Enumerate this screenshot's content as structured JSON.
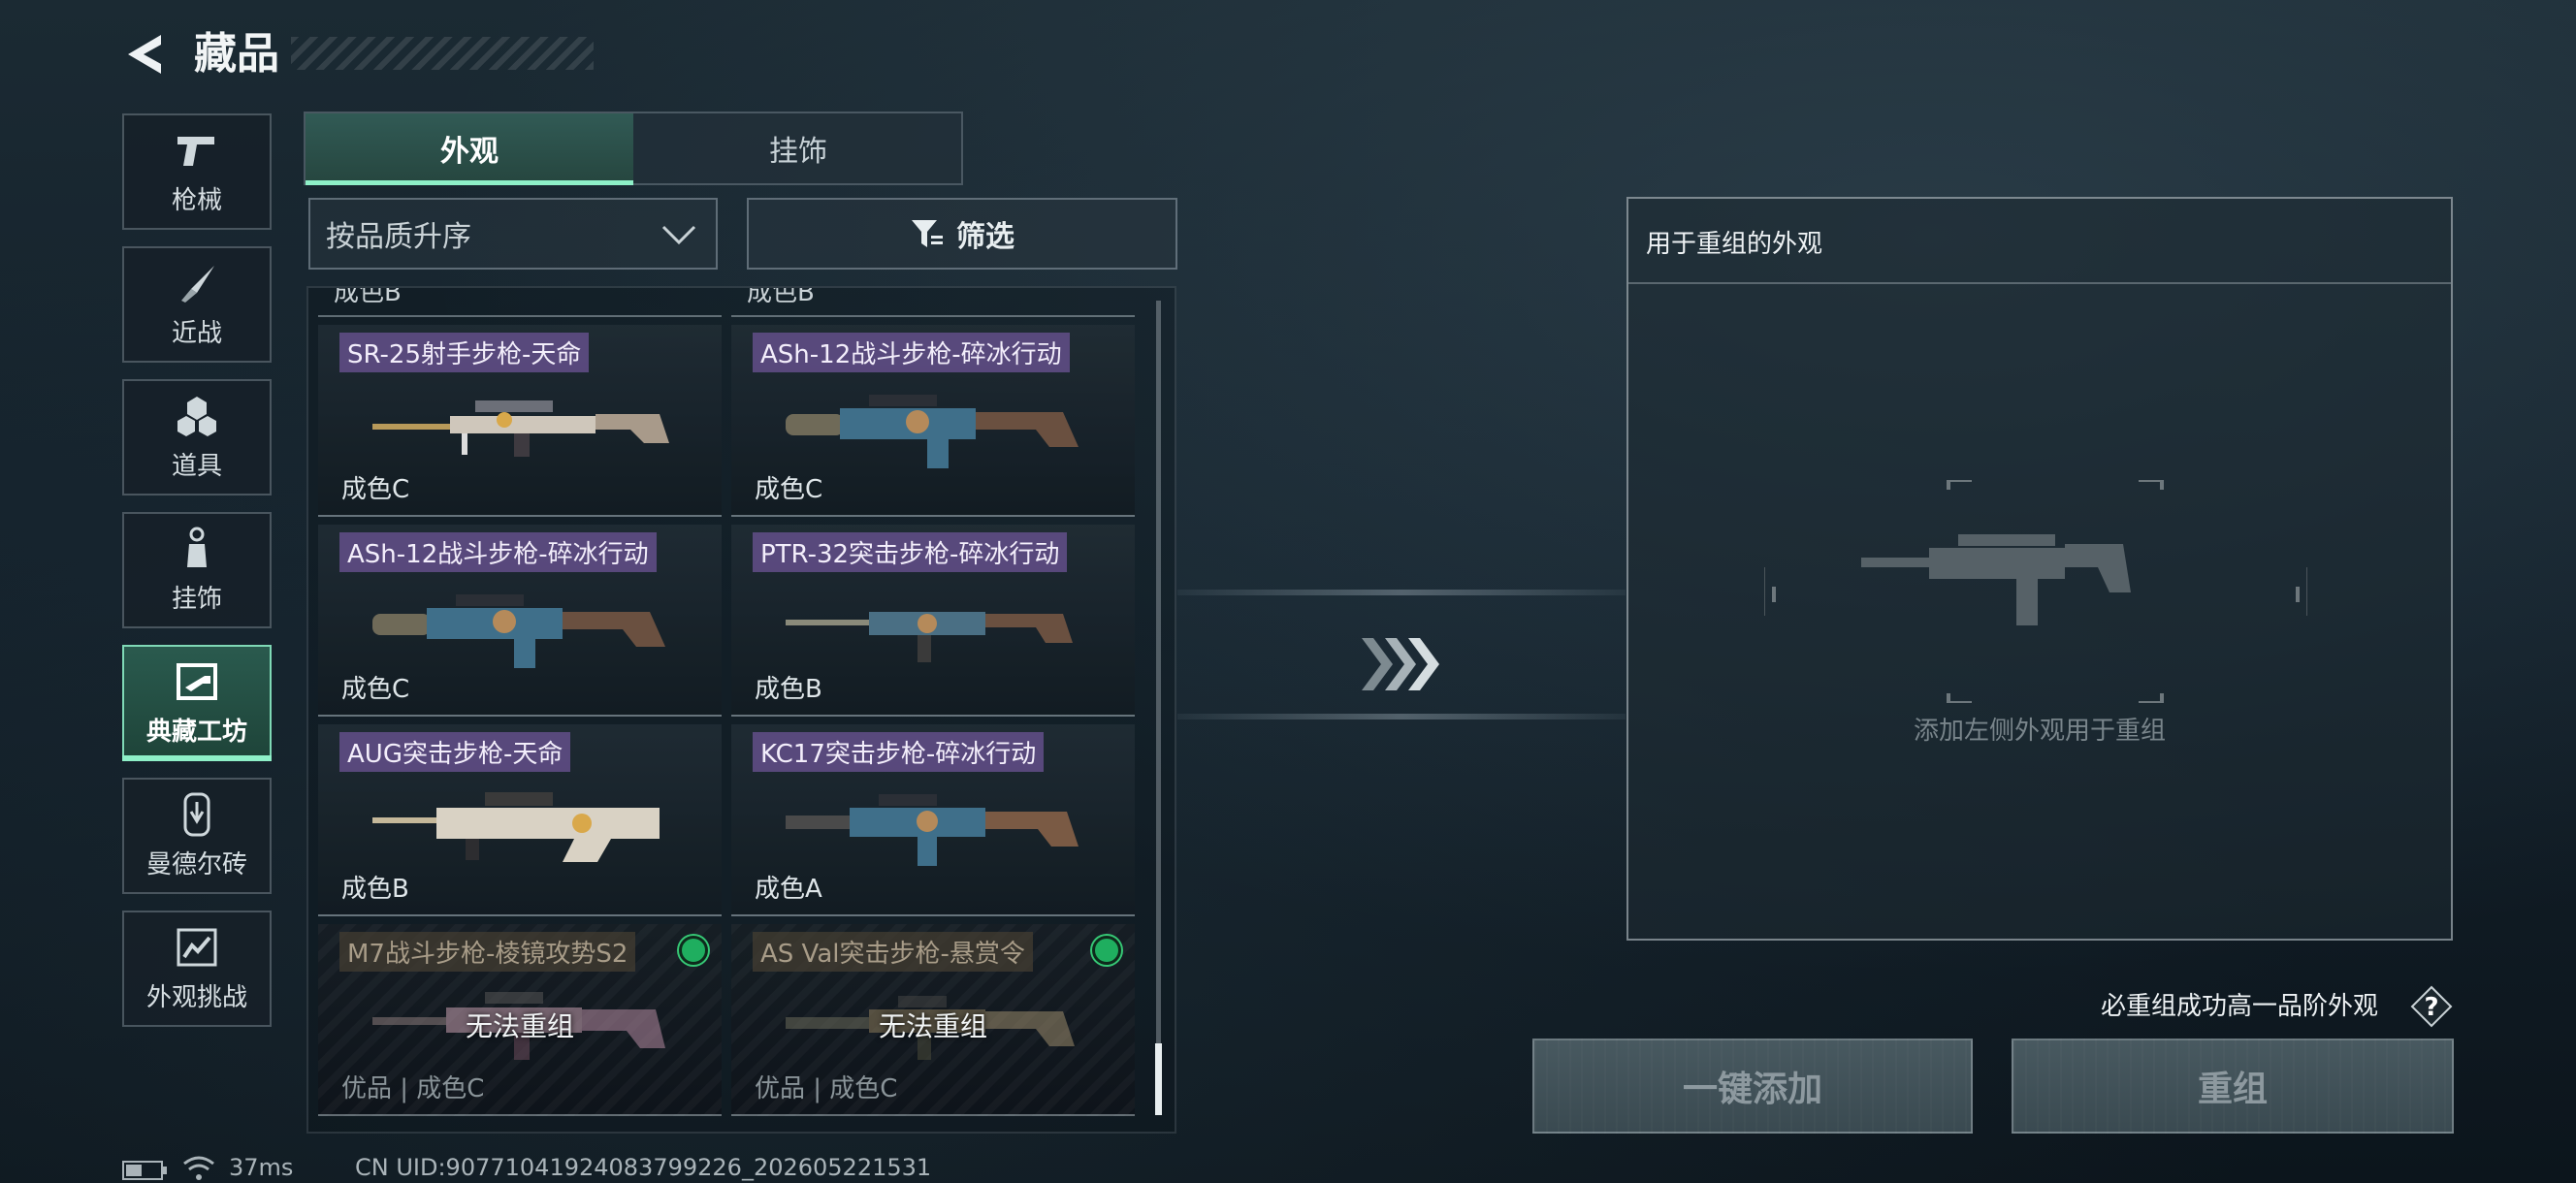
{
  "header": {
    "title": "藏品",
    "back_icon": "back-arrow-icon"
  },
  "nav": {
    "items": [
      {
        "label": "枪械",
        "icon": "pistol-icon",
        "active": false
      },
      {
        "label": "近战",
        "icon": "knife-icon",
        "active": false
      },
      {
        "label": "道具",
        "icon": "grenade-cluster-icon",
        "active": false
      },
      {
        "label": "挂饰",
        "icon": "keychain-icon",
        "active": false
      },
      {
        "label": "典藏工坊",
        "icon": "workshop-icon",
        "active": true
      },
      {
        "label": "曼德尔砖",
        "icon": "mandel-brick-icon",
        "active": false
      },
      {
        "label": "外观挑战",
        "icon": "challenge-icon",
        "active": false
      }
    ]
  },
  "tabs": {
    "appearance": "外观",
    "pendant": "挂饰",
    "selected": "外观"
  },
  "sort": {
    "label": "按品质升序"
  },
  "filter": {
    "label": "筛选"
  },
  "grid": {
    "cut_labels": [
      "成色B",
      "成色B"
    ],
    "cards": [
      {
        "name": "SR-25射手步枪-天命",
        "grade": "成色C",
        "locked": false
      },
      {
        "name": "ASh-12战斗步枪-碎冰行动",
        "grade": "成色C",
        "locked": false
      },
      {
        "name": "ASh-12战斗步枪-碎冰行动",
        "grade": "成色C",
        "locked": false
      },
      {
        "name": "PTR-32突击步枪-碎冰行动",
        "grade": "成色B",
        "locked": false
      },
      {
        "name": "AUG突击步枪-天命",
        "grade": "成色B",
        "locked": false
      },
      {
        "name": "KC17突击步枪-碎冰行动",
        "grade": "成色A",
        "locked": false
      },
      {
        "name": "M7战斗步枪-棱镜攻势S2",
        "grade": "优品 | 成色C",
        "locked": true,
        "lock_text": "无法重组"
      },
      {
        "name": "AS Val突击步枪-悬赏令",
        "grade": "优品 | 成色C",
        "locked": true,
        "lock_text": "无法重组"
      }
    ]
  },
  "recombine": {
    "title": "用于重组的外观",
    "placeholder": "添加左侧外观用于重组",
    "guarantee": "必重组成功高一品阶外观",
    "help_icon": "question-mark-icon",
    "add_all_button": "一键添加",
    "recombine_button": "重组"
  },
  "footer": {
    "ping": "37ms",
    "uid": "CN UID:90771041924083799226_202605221531"
  },
  "colors": {
    "accent": "#8ef0c8",
    "name_tag": "#6c5496",
    "status_green": "#1fae5f"
  }
}
